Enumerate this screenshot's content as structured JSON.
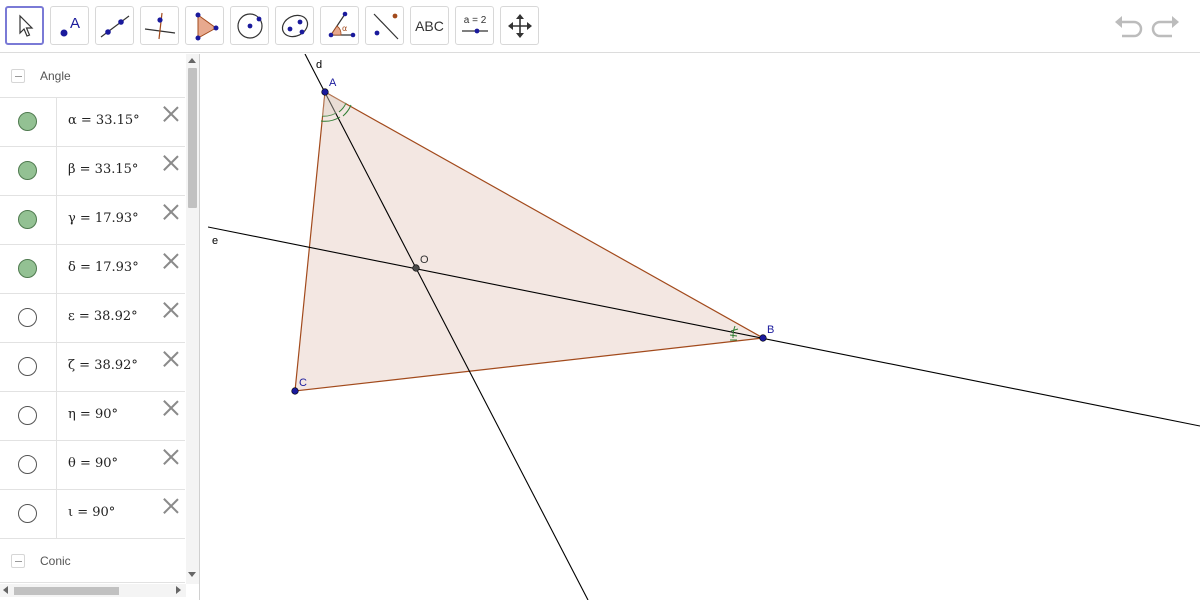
{
  "toolbar": {
    "tools": [
      {
        "name": "move",
        "label": ""
      },
      {
        "name": "point",
        "label": "A"
      },
      {
        "name": "line",
        "label": ""
      },
      {
        "name": "perpendicular-line",
        "label": ""
      },
      {
        "name": "polygon",
        "label": ""
      },
      {
        "name": "circle",
        "label": ""
      },
      {
        "name": "ellipse",
        "label": ""
      },
      {
        "name": "angle",
        "label": "α"
      },
      {
        "name": "reflect",
        "label": ""
      },
      {
        "name": "text",
        "label": "ABC"
      },
      {
        "name": "slider",
        "label": "a = 2"
      },
      {
        "name": "move-graphics-view",
        "label": ""
      }
    ],
    "selected_tool": "move"
  },
  "algebra": {
    "groups": [
      {
        "label": "Angle",
        "collapsed": false,
        "items": [
          {
            "formula": "α = 33.15°",
            "visible": true
          },
          {
            "formula": "β = 33.15°",
            "visible": true
          },
          {
            "formula": "γ = 17.93°",
            "visible": true
          },
          {
            "formula": "δ = 17.93°",
            "visible": true
          },
          {
            "formula": "ε = 38.92°",
            "visible": false
          },
          {
            "formula": "ζ = 38.92°",
            "visible": false
          },
          {
            "formula": "η = 90°",
            "visible": false
          },
          {
            "formula": "θ = 90°",
            "visible": false
          },
          {
            "formula": "ι = 90°",
            "visible": false
          }
        ]
      },
      {
        "label": "Conic",
        "collapsed": false,
        "items": []
      }
    ]
  },
  "graphics": {
    "points": {
      "A": {
        "label": "A"
      },
      "B": {
        "label": "B"
      },
      "C": {
        "label": "C"
      },
      "O": {
        "label": "O"
      }
    },
    "lines": {
      "d": {
        "label": "d"
      },
      "e": {
        "label": "e"
      }
    },
    "colors": {
      "polygon_fill": "#f3e7e2",
      "polygon_stroke": "#a24a1c",
      "point": "#1a1a9c",
      "line": "#000000",
      "angle": "#2e7d32",
      "marble_on": "#93c193"
    }
  }
}
